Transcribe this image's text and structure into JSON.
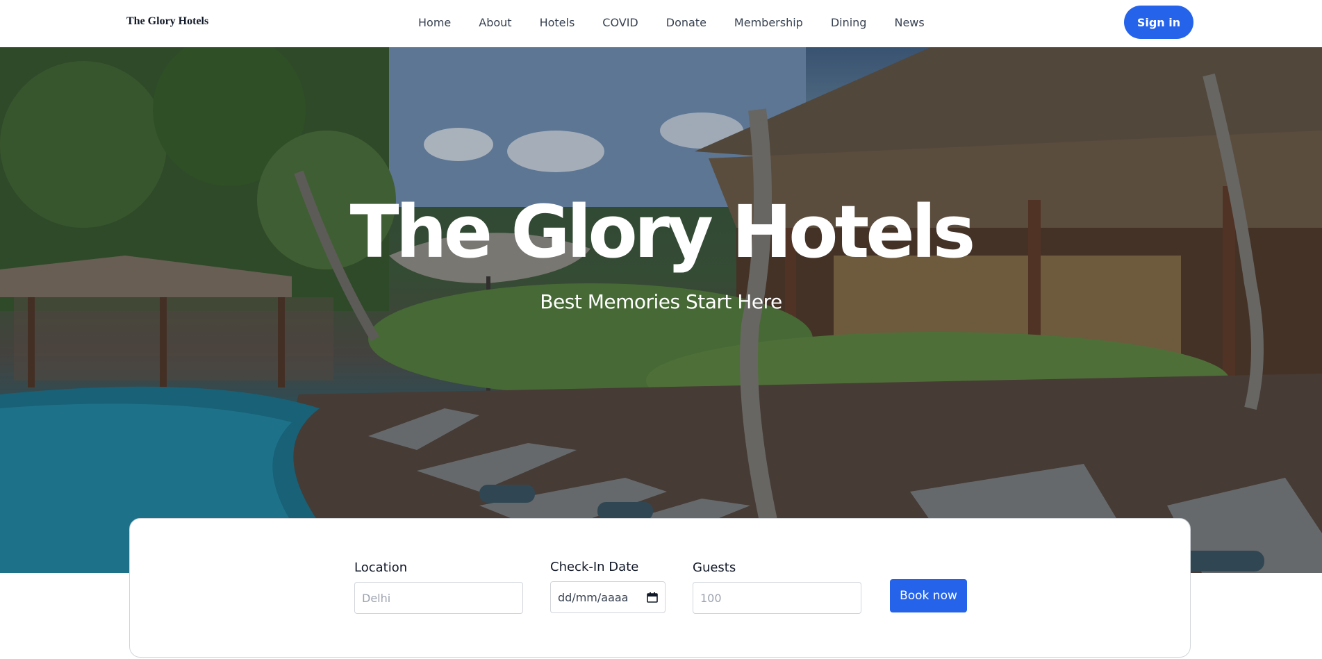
{
  "header": {
    "logo": "The Glory Hotels",
    "nav": [
      "Home",
      "About",
      "Hotels",
      "COVID",
      "Donate",
      "Membership",
      "Dining",
      "News"
    ],
    "signin_label": "Sign in"
  },
  "hero": {
    "title": "The Glory Hotels",
    "subtitle": "Best Memories Start Here"
  },
  "booking": {
    "location": {
      "label": "Location",
      "placeholder": "Delhi"
    },
    "checkin": {
      "label": "Check-In Date",
      "placeholder": "dd/mm/aaaa"
    },
    "guests": {
      "label": "Guests",
      "placeholder": "100"
    },
    "book_label": "Book now"
  },
  "colors": {
    "accent": "#2563eb",
    "border": "#d1d5db"
  }
}
